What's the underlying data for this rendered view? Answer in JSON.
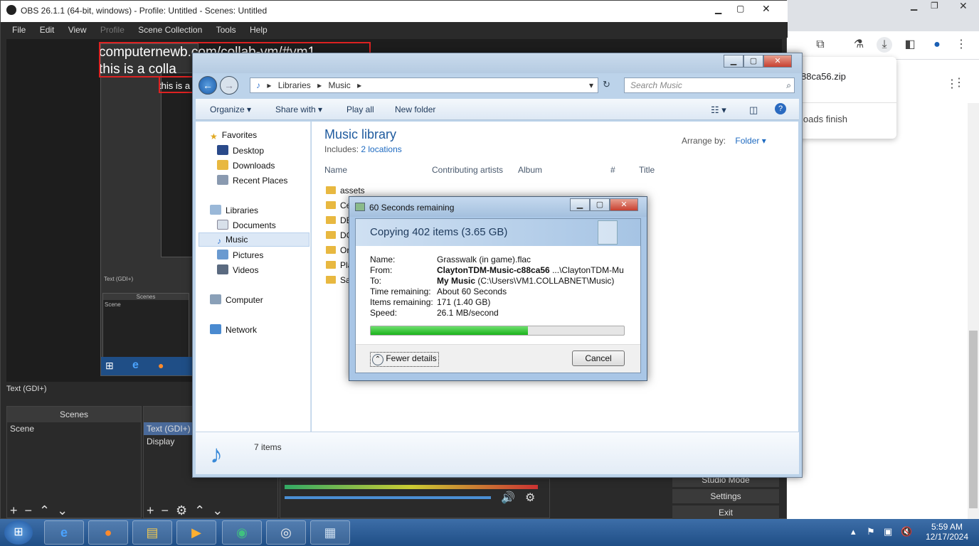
{
  "obs": {
    "title": "OBS 26.1.1 (64-bit, windows) - Profile: Untitled - Scenes: Untitled",
    "menu": [
      "File",
      "Edit",
      "View",
      "Profile",
      "Scene Collection",
      "Tools",
      "Help"
    ],
    "overlay_line1": "computernewb.com/collab-vm/#vm1",
    "overlay_line2": "this is a colla",
    "overlay_line3": "this is a",
    "source_label": "Text (GDI+)",
    "scenes_header": "Scenes",
    "scene_item": "Scene",
    "source_item": "Display",
    "settings_label": "Settings",
    "exit_label": "Exit",
    "studio_label": "Studio Mode"
  },
  "chrome": {
    "download_file": "88ca56.zip",
    "download_msg": "loads finish"
  },
  "explorer": {
    "breadcrumb": [
      "Libraries",
      "Music"
    ],
    "search_placeholder": "Search Music",
    "commands": [
      "Organize",
      "Share with",
      "Play all",
      "New folder"
    ],
    "nav": {
      "favorites": "Favorites",
      "desktop": "Desktop",
      "downloads": "Downloads",
      "recent": "Recent Places",
      "libraries": "Libraries",
      "documents": "Documents",
      "music": "Music",
      "pictures": "Pictures",
      "videos": "Videos",
      "computer": "Computer",
      "network": "Network"
    },
    "library_title": "Music library",
    "includes_label": "Includes:",
    "includes_link": "2 locations",
    "arrange_label": "Arrange by:",
    "arrange_value": "Folder",
    "columns": [
      "Name",
      "Contributing artists",
      "Album",
      "#",
      "Title"
    ],
    "folders": [
      "assets",
      "Ce",
      "DE",
      "DC",
      "Or",
      "Pla",
      "Sa"
    ],
    "status_count": "7 items"
  },
  "copy_dialog": {
    "title": "60 Seconds remaining",
    "heading": "Copying 402 items (3.65 GB)",
    "name_label": "Name:",
    "name_value": "Grasswalk (in game).flac",
    "from_label": "From:",
    "from_bold": "ClaytonTDM-Music-c88ca56",
    "from_rest": "...\\ClaytonTDM-Mu",
    "to_label": "To:",
    "to_bold": "My Music",
    "to_rest": "(C:\\Users\\VM1.COLLABNET\\Music)",
    "time_label": "Time remaining:",
    "time_value": "About 60 Seconds",
    "items_label": "Items remaining:",
    "items_value": "171 (1.40 GB)",
    "speed_label": "Speed:",
    "speed_value": "26.1 MB/second",
    "progress_fraction": 0.62,
    "fewer_details": "Fewer details",
    "cancel": "Cancel"
  },
  "taskbar": {
    "time": "5:59 AM",
    "date": "12/17/2024"
  }
}
